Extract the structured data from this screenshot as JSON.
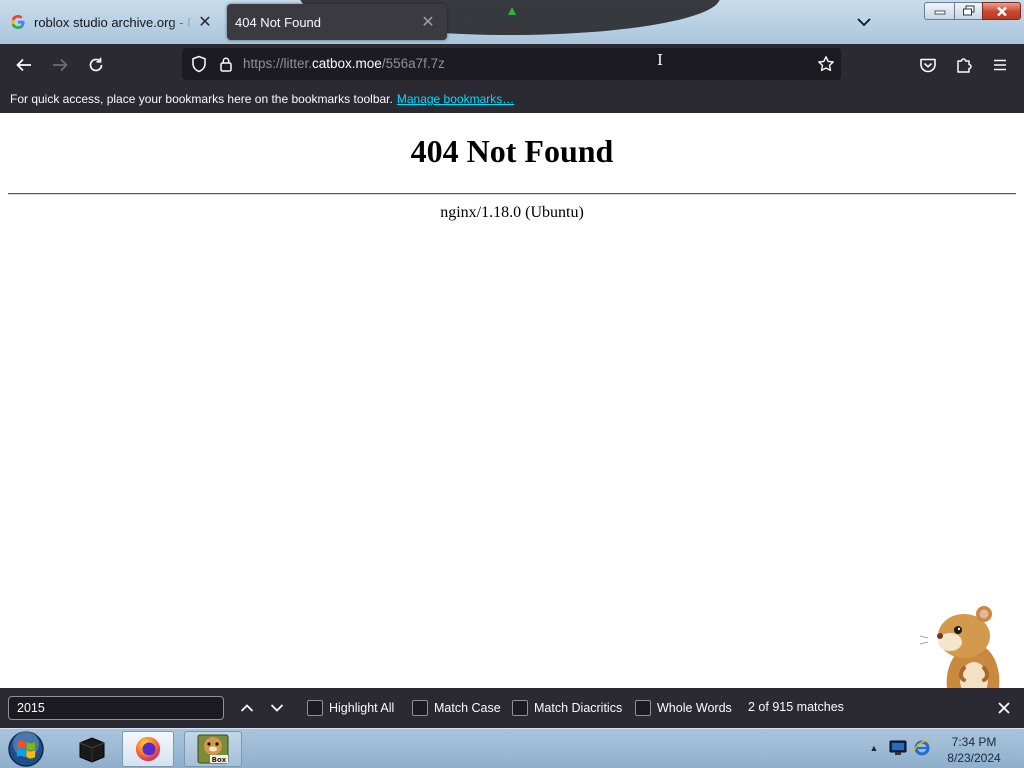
{
  "browser": {
    "tabs": [
      {
        "title": "roblox studio archive.org - Пои",
        "favicon": "google-g-icon",
        "active": false
      },
      {
        "title": "404 Not Found",
        "favicon": "",
        "active": true
      }
    ],
    "url": {
      "prefix": "https://litter.",
      "host": "catbox.moe",
      "path": "/556a7f.7z"
    },
    "bookmarks_bar": {
      "message": "For quick access, place your bookmarks here on the bookmarks toolbar.",
      "manage_link": "Manage bookmarks…"
    },
    "colors": {
      "toolbar": "#2b2a33",
      "urlbar": "#1c1b22",
      "link": "#00ddff",
      "active_tab": "#3b3a41"
    }
  },
  "page": {
    "title": "404 Not Found",
    "server_signature": "nginx/1.18.0 (Ubuntu)"
  },
  "findbar": {
    "query": "2015",
    "options": [
      {
        "label": "Highlight All",
        "checked": false
      },
      {
        "label": "Match Case",
        "checked": false
      },
      {
        "label": "Match Diacritics",
        "checked": false
      },
      {
        "label": "Whole Words",
        "checked": false
      }
    ],
    "status": "2 of 915 matches"
  },
  "taskbar": {
    "apps": [
      "command-prompt-icon",
      "firefox-icon",
      "box-app-icon"
    ],
    "box_app_label": "Box",
    "clock": {
      "time": "7:34 PM",
      "date": "8/23/2024"
    }
  }
}
